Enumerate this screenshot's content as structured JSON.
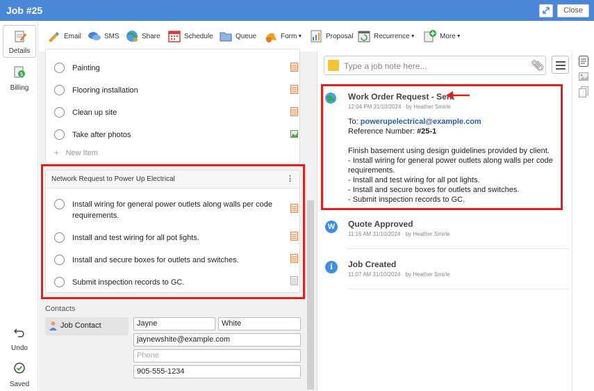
{
  "window": {
    "title": "Job #25",
    "close_label": "Close"
  },
  "leftnav": {
    "items": [
      {
        "label": "Details",
        "icon": "clipboard-edit-icon"
      },
      {
        "label": "Billing",
        "icon": "billing-dollar-icon"
      }
    ],
    "undo_label": "Undo",
    "saved_label": "Saved"
  },
  "toolbar": {
    "items": [
      {
        "label": "Email",
        "icon": "email-pencil-icon"
      },
      {
        "label": "SMS",
        "icon": "sms-chat-icon"
      },
      {
        "label": "Share",
        "icon": "share-globe-icon"
      },
      {
        "label": "Schedule",
        "icon": "calendar-icon"
      },
      {
        "label": "Queue",
        "icon": "folder-icon"
      },
      {
        "label": "Form",
        "icon": "form-icon"
      },
      {
        "label": "Proposal",
        "icon": "proposal-chart-icon"
      },
      {
        "label": "Recurrence",
        "icon": "recurrence-icon"
      },
      {
        "label": "More",
        "icon": "more-plus-icon"
      }
    ]
  },
  "checklist": {
    "items": [
      {
        "label": "Painting"
      },
      {
        "label": "Flooring installation"
      },
      {
        "label": "Clean up site"
      },
      {
        "label": "Take after photos"
      }
    ],
    "new_item": "New Item"
  },
  "group": {
    "title": "Network Request to Power Up Electrical",
    "items": [
      {
        "label": "Install wiring for general power outlets along walls per code requirements."
      },
      {
        "label": "Install and test wiring for all pot lights."
      },
      {
        "label": "Install and secure boxes for outlets and switches."
      },
      {
        "label": "Submit inspection records to GC."
      }
    ]
  },
  "contacts": {
    "label": "Contacts",
    "job_contact": "Job Contact",
    "first_name": "Jayne",
    "last_name": "White",
    "email": "jaynewshite@example.com",
    "phone_placeholder": "Phone",
    "mobile": "905-555-1234"
  },
  "notes": {
    "placeholder": "Type a job note here..."
  },
  "activity": [
    {
      "title": "Work Order Request - Sent",
      "time": "12:04 PM 31/10/2024",
      "by": "by Heather Smirle",
      "to_label": "To:",
      "to_email": "powerupelectrical@example.com",
      "ref_label": "Reference Number:",
      "ref_value": "#25-1",
      "body": [
        "Finish basement using design guidelines provided by client.",
        "- Install wiring for general power outlets along walls per code requirements.",
        "- Install and test wiring for all pot lights.",
        "- Install and secure boxes for outlets and switches.",
        "- Submit inspection records to GC."
      ]
    },
    {
      "title": "Quote Approved",
      "time": "11:16 AM 31/10/2024",
      "by": "by Heather Smirle",
      "icon_letter": "W"
    },
    {
      "title": "Job Created",
      "time": "11:07 AM 31/10/2024",
      "by": "by Heather Smirle",
      "icon_letter": "i"
    }
  ],
  "colors": {
    "titlebar": "#4a87d6",
    "highlight": "#e02020",
    "link": "#2b5fa8",
    "info_icon": "#3d8fe0"
  }
}
